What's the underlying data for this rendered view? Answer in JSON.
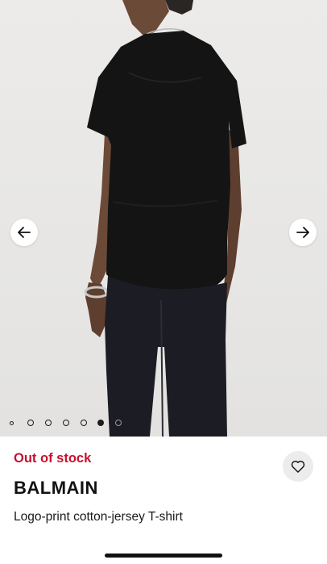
{
  "gallery": {
    "image_alt": "Model wearing black logo-print T-shirt, back view",
    "prev_icon": "arrow-left-icon",
    "next_icon": "arrow-right-icon",
    "slide_count": 7,
    "active_slide": 6
  },
  "product": {
    "stock_status": "Out of stock",
    "brand": "BALMAIN",
    "name": "Logo-print cotton-jersey T-shirt",
    "wishlist_icon": "heart-outline-icon"
  },
  "colors": {
    "stock_red": "#c8102e",
    "text_dark": "#111111",
    "wishlist_bg": "#ececec"
  }
}
